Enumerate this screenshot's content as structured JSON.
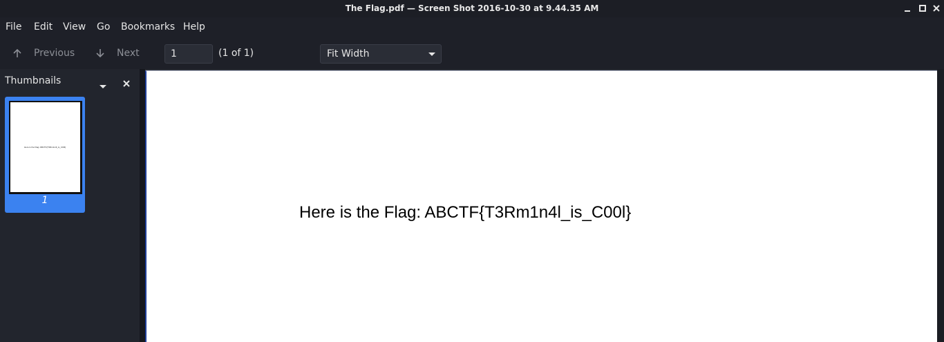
{
  "window": {
    "title": "The Flag.pdf — Screen Shot 2016-10-30 at 9.44.35 AM"
  },
  "menu": [
    "File",
    "Edit",
    "View",
    "Go",
    "Bookmarks",
    "Help"
  ],
  "toolbar": {
    "previous_label": "Previous",
    "next_label": "Next",
    "page_value": "1",
    "page_count": "(1 of 1)",
    "zoom_value": "Fit Width"
  },
  "sidebar": {
    "title": "Thumbnails",
    "thumbnails": [
      {
        "page_label": "1",
        "preview_text": "Here is the Flag: ABCTF{T3Rm1n4l_is_C00l}",
        "selected": true
      }
    ]
  },
  "document": {
    "text": "Here is the Flag: ABCTF{T3Rm1n4l_is_C00l}"
  },
  "icons": {
    "minimize": "minimize-icon",
    "maximize": "maximize-icon",
    "close": "close-icon",
    "previous": "arrow-up-icon",
    "next": "arrow-down-icon",
    "dropdown": "chevron-down-icon"
  },
  "colors": {
    "accent": "#3b82f0",
    "background": "#1e2028",
    "page": "#ffffff"
  }
}
